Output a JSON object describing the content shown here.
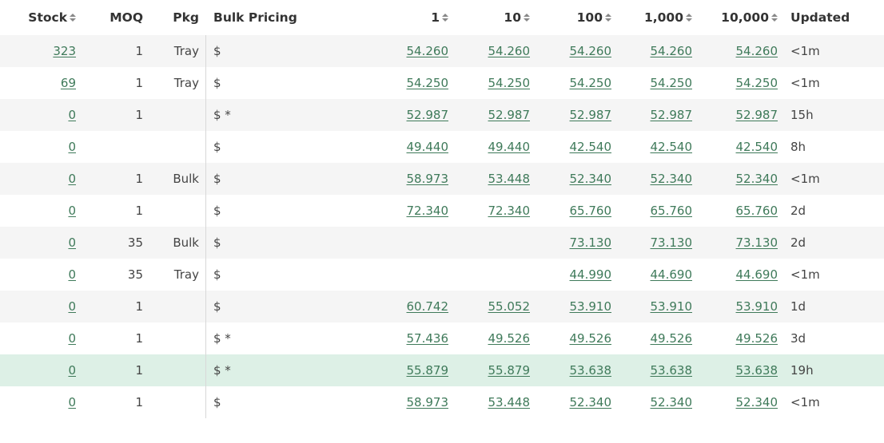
{
  "headers": {
    "stock": "Stock",
    "moq": "MOQ",
    "pkg": "Pkg",
    "bulk": "Bulk Pricing",
    "p1": "1",
    "p2": "10",
    "p3": "100",
    "p4": "1,000",
    "p5": "10,000",
    "updated": "Updated"
  },
  "rows": [
    {
      "stock": "323",
      "moq": "1",
      "pkg": "Tray",
      "bulk": "$",
      "p1": "54.260",
      "p2": "54.260",
      "p3": "54.260",
      "p4": "54.260",
      "p5": "54.260",
      "updated": "<1m"
    },
    {
      "stock": "69",
      "moq": "1",
      "pkg": "Tray",
      "bulk": "$",
      "p1": "54.250",
      "p2": "54.250",
      "p3": "54.250",
      "p4": "54.250",
      "p5": "54.250",
      "updated": "<1m"
    },
    {
      "stock": "0",
      "moq": "1",
      "pkg": "",
      "bulk": "$ *",
      "p1": "52.987",
      "p2": "52.987",
      "p3": "52.987",
      "p4": "52.987",
      "p5": "52.987",
      "updated": "15h"
    },
    {
      "stock": "0",
      "moq": "",
      "pkg": "",
      "bulk": "$",
      "p1": "49.440",
      "p2": "49.440",
      "p3": "42.540",
      "p4": "42.540",
      "p5": "42.540",
      "updated": "8h"
    },
    {
      "stock": "0",
      "moq": "1",
      "pkg": "Bulk",
      "bulk": "$",
      "p1": "58.973",
      "p2": "53.448",
      "p3": "52.340",
      "p4": "52.340",
      "p5": "52.340",
      "updated": "<1m"
    },
    {
      "stock": "0",
      "moq": "1",
      "pkg": "",
      "bulk": "$",
      "p1": "72.340",
      "p2": "72.340",
      "p3": "65.760",
      "p4": "65.760",
      "p5": "65.760",
      "updated": "2d"
    },
    {
      "stock": "0",
      "moq": "35",
      "pkg": "Bulk",
      "bulk": "$",
      "p1": "",
      "p2": "",
      "p3": "73.130",
      "p4": "73.130",
      "p5": "73.130",
      "updated": "2d"
    },
    {
      "stock": "0",
      "moq": "35",
      "pkg": "Tray",
      "bulk": "$",
      "p1": "",
      "p2": "",
      "p3": "44.990",
      "p4": "44.690",
      "p5": "44.690",
      "updated": "<1m"
    },
    {
      "stock": "0",
      "moq": "1",
      "pkg": "",
      "bulk": "$",
      "p1": "60.742",
      "p2": "55.052",
      "p3": "53.910",
      "p4": "53.910",
      "p5": "53.910",
      "updated": "1d"
    },
    {
      "stock": "0",
      "moq": "1",
      "pkg": "",
      "bulk": "$ *",
      "p1": "57.436",
      "p2": "49.526",
      "p3": "49.526",
      "p4": "49.526",
      "p5": "49.526",
      "updated": "3d"
    },
    {
      "stock": "0",
      "moq": "1",
      "pkg": "",
      "bulk": "$ *",
      "p1": "55.879",
      "p2": "55.879",
      "p3": "53.638",
      "p4": "53.638",
      "p5": "53.638",
      "updated": "19h"
    },
    {
      "stock": "0",
      "moq": "1",
      "pkg": "",
      "bulk": "$",
      "p1": "58.973",
      "p2": "53.448",
      "p3": "52.340",
      "p4": "52.340",
      "p5": "52.340",
      "updated": "<1m"
    }
  ],
  "highlight_row_index": 10,
  "colors": {
    "link": "#3f7a5a",
    "stripe": "#f5f5f5",
    "highlight": "#ddf0e6"
  },
  "icons": {
    "sort": "sort-updown-icon"
  }
}
